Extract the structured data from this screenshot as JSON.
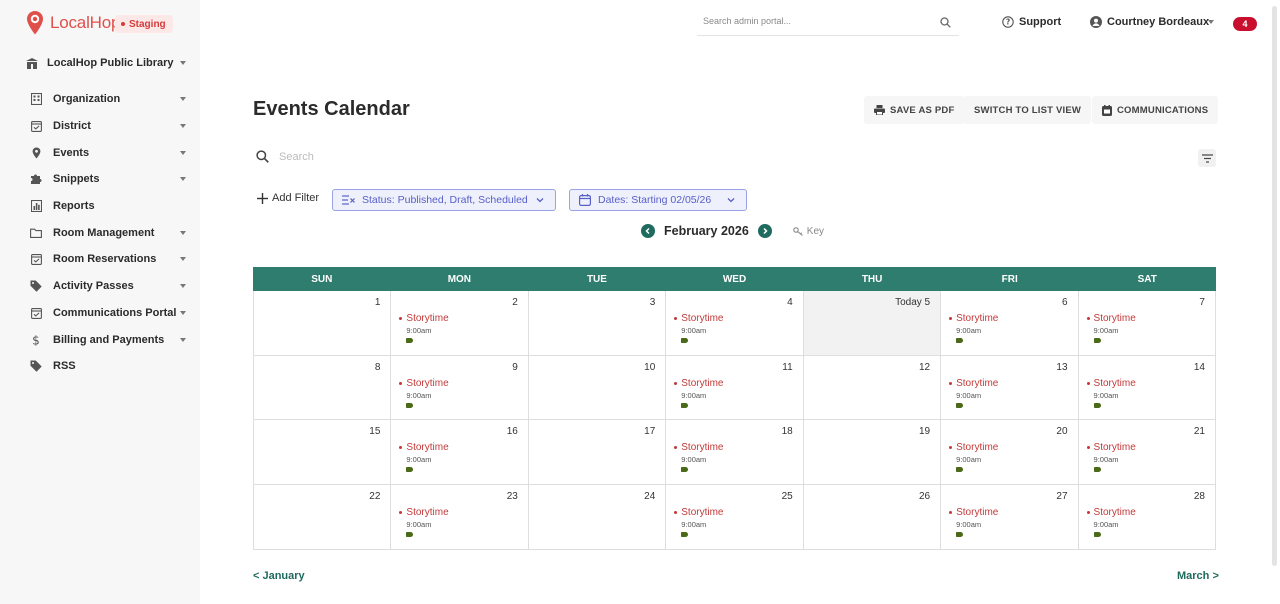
{
  "brand": {
    "name": "LocalHop",
    "env": "Staging",
    "primary_color": "#2e7d6f",
    "accent_color": "#e0504a"
  },
  "header": {
    "search_placeholder": "Search admin portal...",
    "support": "Support",
    "user": "Courtney Bordeaux",
    "notification_count": "4"
  },
  "sidebar": {
    "org": "LocalHop Public Library",
    "items": [
      {
        "label": "Organization",
        "icon": "building-icon",
        "has_menu": true
      },
      {
        "label": "District",
        "icon": "calendar-check-icon",
        "has_menu": true
      },
      {
        "label": "Events",
        "icon": "pin-icon",
        "has_menu": true
      },
      {
        "label": "Snippets",
        "icon": "puzzle-icon",
        "has_menu": true
      },
      {
        "label": "Reports",
        "icon": "chart-icon",
        "has_menu": false
      },
      {
        "label": "Room Management",
        "icon": "folder-icon",
        "has_menu": true
      },
      {
        "label": "Room Reservations",
        "icon": "calendar-check-icon",
        "has_menu": true
      },
      {
        "label": "Activity Passes",
        "icon": "tag-icon",
        "has_menu": true
      },
      {
        "label": "Communications Portal",
        "icon": "calendar-check-icon",
        "has_menu": true
      },
      {
        "label": "Billing and Payments",
        "icon": "dollar-icon",
        "has_menu": true
      },
      {
        "label": "RSS",
        "icon": "tag-icon",
        "has_menu": false
      }
    ]
  },
  "main": {
    "title": "Events Calendar",
    "actions": {
      "pdf": "SAVE AS PDF",
      "list": "SWITCH TO LIST VIEW",
      "comm": "COMMUNICATIONS"
    },
    "search_placeholder": "Search",
    "add_filter": "Add Filter",
    "status_filter": "Status: Published, Draft, Scheduled",
    "dates_filter": "Dates: Starting 02/05/26",
    "month": "February 2026",
    "key": "Key",
    "prev": "< January",
    "next": "March >"
  },
  "calendar": {
    "weekdays": [
      "SUN",
      "MON",
      "TUE",
      "WED",
      "THU",
      "FRI",
      "SAT"
    ],
    "weeks": [
      [
        {
          "day": "1",
          "events": []
        },
        {
          "day": "2",
          "events": [
            {
              "title": "Storytime",
              "time": "9:00am"
            }
          ]
        },
        {
          "day": "3",
          "events": []
        },
        {
          "day": "4",
          "events": [
            {
              "title": "Storytime",
              "time": "9:00am"
            }
          ]
        },
        {
          "day": "Today 5",
          "today": true,
          "events": []
        },
        {
          "day": "6",
          "events": [
            {
              "title": "Storytime",
              "time": "9:00am"
            }
          ]
        },
        {
          "day": "7",
          "events": [
            {
              "title": "Storytime",
              "time": "9:00am"
            }
          ]
        }
      ],
      [
        {
          "day": "8",
          "events": []
        },
        {
          "day": "9",
          "events": [
            {
              "title": "Storytime",
              "time": "9:00am"
            }
          ]
        },
        {
          "day": "10",
          "events": []
        },
        {
          "day": "11",
          "events": [
            {
              "title": "Storytime",
              "time": "9:00am"
            }
          ]
        },
        {
          "day": "12",
          "events": []
        },
        {
          "day": "13",
          "events": [
            {
              "title": "Storytime",
              "time": "9:00am"
            }
          ]
        },
        {
          "day": "14",
          "events": [
            {
              "title": "Storytime",
              "time": "9:00am"
            }
          ]
        }
      ],
      [
        {
          "day": "15",
          "events": []
        },
        {
          "day": "16",
          "events": [
            {
              "title": "Storytime",
              "time": "9:00am"
            }
          ]
        },
        {
          "day": "17",
          "events": []
        },
        {
          "day": "18",
          "events": [
            {
              "title": "Storytime",
              "time": "9:00am"
            }
          ]
        },
        {
          "day": "19",
          "events": []
        },
        {
          "day": "20",
          "events": [
            {
              "title": "Storytime",
              "time": "9:00am"
            }
          ]
        },
        {
          "day": "21",
          "events": [
            {
              "title": "Storytime",
              "time": "9:00am"
            }
          ]
        }
      ],
      [
        {
          "day": "22",
          "events": []
        },
        {
          "day": "23",
          "events": [
            {
              "title": "Storytime",
              "time": "9:00am"
            }
          ]
        },
        {
          "day": "24",
          "events": []
        },
        {
          "day": "25",
          "events": [
            {
              "title": "Storytime",
              "time": "9:00am"
            }
          ]
        },
        {
          "day": "26",
          "events": []
        },
        {
          "day": "27",
          "events": [
            {
              "title": "Storytime",
              "time": "9:00am"
            }
          ]
        },
        {
          "day": "28",
          "events": [
            {
              "title": "Storytime",
              "time": "9:00am"
            }
          ]
        }
      ]
    ]
  }
}
